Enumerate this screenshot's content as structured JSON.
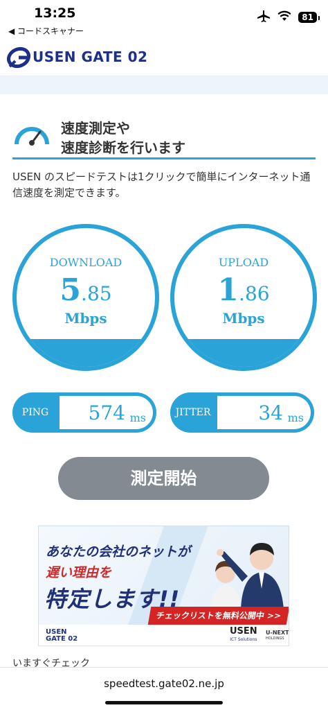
{
  "status": {
    "time": "13:25",
    "back_app": "◀ コードスキャナー",
    "battery": "81"
  },
  "header": {
    "logo_text": "USEN GATE 02"
  },
  "section": {
    "title_line1": "速度測定や",
    "title_line2": "速度診断を行います",
    "description": "USEN のスピードテストは1クリックで簡単にインターネット通信速度を測定できます。"
  },
  "download": {
    "label": "DOWNLOAD",
    "value_int": "5",
    "value_dec": ".85",
    "unit": "Mbps"
  },
  "upload": {
    "label": "UPLOAD",
    "value_int": "1",
    "value_dec": ".86",
    "unit": "Mbps"
  },
  "ping": {
    "label": "PING",
    "value": "574",
    "unit": "ms"
  },
  "jitter": {
    "label": "JITTER",
    "value": "34",
    "unit": "ms"
  },
  "measure_button": "測定開始",
  "banner": {
    "line1": "あなたの会社のネットが",
    "line2": "遅い理由を",
    "line3": "特定します!!",
    "cta": "チェックリストを無料公開中 >>",
    "logo1_line1": "USEN",
    "logo1_line2": "GATE 02",
    "logo2": "USEN",
    "logo2_sub": "ICT Solutions",
    "logo3_line1": "U-NEXT",
    "logo3_line2": "HOLDINGS"
  },
  "check_text": "いますぐチェック",
  "url": "speedtest.gate02.ne.jp",
  "colors": {
    "accent": "#2aa3d9",
    "brand_navy": "#1e2f8a",
    "button_gray": "#838a91",
    "banner_red": "#d52424"
  }
}
